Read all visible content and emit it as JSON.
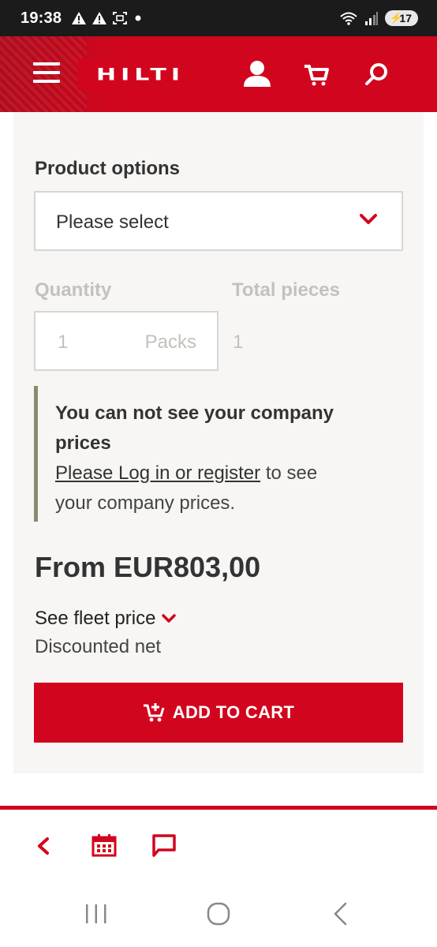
{
  "status_bar": {
    "time": "19:38",
    "battery": "17",
    "left_icons": [
      "warning-icon",
      "warning-icon",
      "screenshot-icon",
      "dot-icon"
    ],
    "right_icons": [
      "wifi-icon",
      "signal-icon",
      "battery-icon"
    ]
  },
  "header": {
    "logo_text": "HILTI",
    "brand_color": "#d2051e",
    "icons": [
      "menu-icon",
      "user-icon",
      "cart-icon",
      "search-icon"
    ]
  },
  "product_options": {
    "label": "Product options",
    "placeholder": "Please select"
  },
  "quantity": {
    "label": "Quantity",
    "value": "1",
    "unit": "Packs"
  },
  "total_pieces": {
    "label": "Total pieces",
    "value": "1"
  },
  "notice": {
    "title_line1": "You can not see your company",
    "title_line2": "prices",
    "link_text": "Please Log in or register",
    "body_after_link": " to see",
    "body_line2": "your company prices."
  },
  "price": {
    "text": "From EUR803,00"
  },
  "fleet": {
    "label": "See fleet price",
    "subtext": "Discounted net"
  },
  "add_to_cart": {
    "label": "ADD TO CART"
  },
  "toolbar": {
    "icons": [
      "back-icon",
      "calendar-icon",
      "chat-icon"
    ]
  },
  "navbar": {
    "icons": [
      "recent-apps-icon",
      "home-icon",
      "back-nav-icon"
    ]
  }
}
